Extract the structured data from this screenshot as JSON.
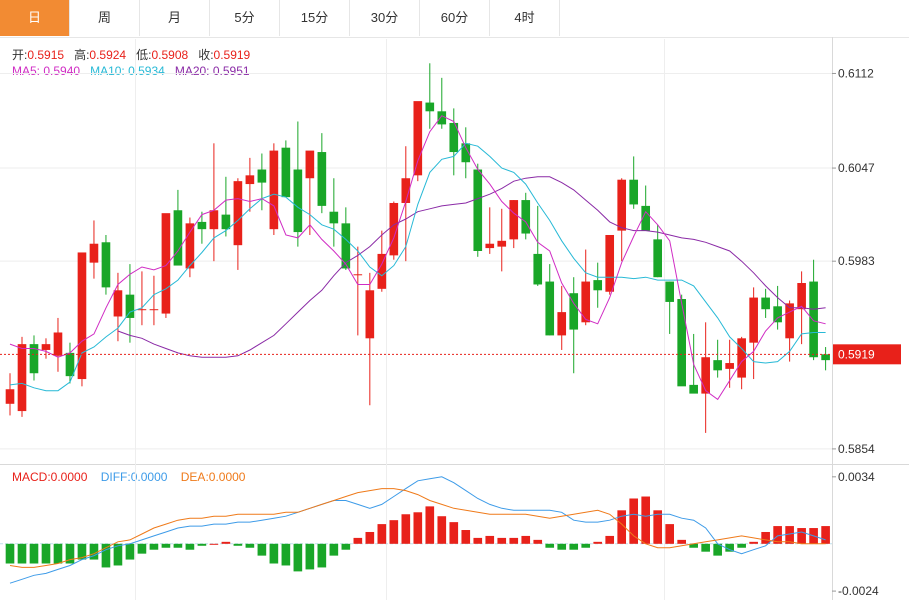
{
  "tabs": [
    {
      "label": "日",
      "active": true
    },
    {
      "label": "周"
    },
    {
      "label": "月"
    },
    {
      "label": "5分"
    },
    {
      "label": "15分"
    },
    {
      "label": "30分"
    },
    {
      "label": "60分"
    },
    {
      "label": "4时"
    }
  ],
  "info": {
    "open_label": "开:",
    "open_value": "0.5915",
    "high_label": "高:",
    "high_value": "0.5924",
    "low_label": "低:",
    "low_value": "0.5908",
    "close_label": "收:",
    "close_value": "0.5919",
    "ma5_label": "MA5:",
    "ma5_value": "0.5940",
    "ma10_label": "MA10:",
    "ma10_value": "0.5934",
    "ma20_label": "MA20:",
    "ma20_value": "0.5951"
  },
  "macd_info": {
    "macd_label": "MACD:",
    "macd_value": "0.0000",
    "diff_label": "DIFF:",
    "diff_value": "0.0000",
    "dea_label": "DEA:",
    "dea_value": "0.0000"
  },
  "colors": {
    "up": "#e8211a",
    "down": "#19a628",
    "ma5": "#d02cc4",
    "ma10": "#27b9d6",
    "ma20": "#8a2aa6",
    "diff": "#3d9be8",
    "dea": "#ef7a1a",
    "accent": "#f28b33"
  },
  "chart_data": [
    {
      "type": "candlestick",
      "ylim": [
        0.5845,
        0.6135
      ],
      "yticks": [
        "0.6112",
        "0.6047",
        "0.5983",
        "0.5854"
      ],
      "last_price": "0.5919",
      "candles": [
        [
          0.5885,
          0.5906,
          0.5877,
          0.5895
        ],
        [
          0.588,
          0.5931,
          0.5876,
          0.5926
        ],
        [
          0.5926,
          0.5932,
          0.5901,
          0.5906
        ],
        [
          0.5922,
          0.593,
          0.5916,
          0.5926
        ],
        [
          0.5918,
          0.5944,
          0.5907,
          0.5934
        ],
        [
          0.592,
          0.5927,
          0.5899,
          0.5904
        ],
        [
          0.5902,
          0.5931,
          0.5897,
          0.5989
        ],
        [
          0.5982,
          0.6011,
          0.5971,
          0.5995
        ],
        [
          0.5996,
          0.6001,
          0.596,
          0.5965
        ],
        [
          0.5945,
          0.5975,
          0.5928,
          0.5963
        ],
        [
          0.596,
          0.5981,
          0.5927,
          0.5944
        ],
        [
          0.595,
          0.5976,
          0.5939,
          0.595
        ],
        [
          0.595,
          0.5973,
          0.5939,
          0.595
        ],
        [
          0.5947,
          0.6,
          0.5944,
          0.6016
        ],
        [
          0.6018,
          0.6032,
          0.5993,
          0.598
        ],
        [
          0.5978,
          0.6013,
          0.5972,
          0.6009
        ],
        [
          0.601,
          0.6017,
          0.5995,
          0.6005
        ],
        [
          0.6005,
          0.6064,
          0.5983,
          0.6018
        ],
        [
          0.6015,
          0.6041,
          0.6,
          0.6005
        ],
        [
          0.5994,
          0.604,
          0.5977,
          0.6038
        ],
        [
          0.6036,
          0.6054,
          0.6017,
          0.6042
        ],
        [
          0.6046,
          0.6057,
          0.6018,
          0.6037
        ],
        [
          0.6005,
          0.6064,
          0.6001,
          0.6059
        ],
        [
          0.6061,
          0.6066,
          0.6027,
          0.6027
        ],
        [
          0.6046,
          0.6079,
          0.5993,
          0.6003
        ],
        [
          0.604,
          0.6052,
          0.6001,
          0.6059
        ],
        [
          0.6058,
          0.6071,
          0.6016,
          0.6021
        ],
        [
          0.6017,
          0.604,
          0.5993,
          0.6009
        ],
        [
          0.6009,
          0.602,
          0.5977,
          0.5978
        ],
        [
          0.5974,
          0.5993,
          0.5932,
          0.5974
        ],
        [
          0.593,
          0.5975,
          0.5884,
          0.5963
        ],
        [
          0.5964,
          0.6004,
          0.5962,
          0.5988
        ],
        [
          0.5987,
          0.6024,
          0.5984,
          0.6023
        ],
        [
          0.6023,
          0.6062,
          0.5983,
          0.604
        ],
        [
          0.6042,
          0.606,
          0.6038,
          0.6093
        ],
        [
          0.6092,
          0.6119,
          0.6074,
          0.6086
        ],
        [
          0.6086,
          0.6109,
          0.6074,
          0.6077
        ],
        [
          0.6078,
          0.6088,
          0.6042,
          0.6058
        ],
        [
          0.6064,
          0.6075,
          0.604,
          0.6051
        ],
        [
          0.6046,
          0.605,
          0.5986,
          0.599
        ],
        [
          0.5992,
          0.602,
          0.5988,
          0.5995
        ],
        [
          0.5993,
          0.6019,
          0.5976,
          0.5997
        ],
        [
          0.5998,
          0.6025,
          0.5992,
          0.6025
        ],
        [
          0.6025,
          0.603,
          0.5998,
          0.6002
        ],
        [
          0.5988,
          0.6021,
          0.5966,
          0.5967
        ],
        [
          0.5969,
          0.5981,
          0.5932,
          0.5932
        ],
        [
          0.5932,
          0.5966,
          0.5922,
          0.5948
        ],
        [
          0.5961,
          0.5972,
          0.5906,
          0.5936
        ],
        [
          0.5941,
          0.5991,
          0.5939,
          0.5969
        ],
        [
          0.597,
          0.5982,
          0.5951,
          0.5963
        ],
        [
          0.5962,
          0.5998,
          0.596,
          0.6001
        ],
        [
          0.6004,
          0.604,
          0.5983,
          0.6039
        ],
        [
          0.6039,
          0.6055,
          0.6019,
          0.6022
        ],
        [
          0.6021,
          0.6035,
          0.6006,
          0.6004
        ],
        [
          0.5998,
          0.6008,
          0.5972,
          0.5972
        ],
        [
          0.5969,
          0.5969,
          0.5933,
          0.5955
        ],
        [
          0.5957,
          0.596,
          0.59,
          0.5897
        ],
        [
          0.5898,
          0.5933,
          0.5893,
          0.5892
        ],
        [
          0.5892,
          0.5941,
          0.5865,
          0.5917
        ],
        [
          0.5915,
          0.5929,
          0.5903,
          0.5908
        ],
        [
          0.5909,
          0.5929,
          0.5896,
          0.5913
        ],
        [
          0.5903,
          0.5931,
          0.5895,
          0.593
        ],
        [
          0.5927,
          0.5965,
          0.5902,
          0.5958
        ],
        [
          0.5958,
          0.5964,
          0.5944,
          0.595
        ],
        [
          0.5952,
          0.5966,
          0.5936,
          0.5941
        ],
        [
          0.593,
          0.5956,
          0.5914,
          0.5954
        ],
        [
          0.595,
          0.5976,
          0.5926,
          0.5968
        ],
        [
          0.5969,
          0.5984,
          0.5915,
          0.5917
        ],
        [
          0.5919,
          0.5924,
          0.5908,
          0.5915
        ]
      ],
      "ma5": [
        0.5926,
        0.5923,
        0.5923,
        0.5921,
        0.5917,
        0.592,
        0.5928,
        0.5933,
        0.5951,
        0.5967,
        0.5974,
        0.5979,
        0.5977,
        0.598,
        0.599,
        0.6003,
        0.6015,
        0.6018,
        0.6025,
        0.6026,
        0.6024,
        0.6026,
        0.6021,
        0.6001,
        0.5999,
        0.6008,
        0.5998,
        0.599,
        0.5981,
        0.5967,
        0.5967,
        0.5981,
        0.5999,
        0.6024,
        0.6052,
        0.6072,
        0.6083,
        0.6079,
        0.6061,
        0.6046,
        0.6036,
        0.6024,
        0.6016,
        0.601,
        0.5996,
        0.599,
        0.5968,
        0.5954,
        0.5943,
        0.594,
        0.5958,
        0.5982,
        0.6,
        0.6017,
        0.6008,
        0.5997,
        0.5954,
        0.5912,
        0.5894,
        0.5888,
        0.5901,
        0.5914,
        0.5921,
        0.5935,
        0.5944,
        0.5948,
        0.5952,
        0.5942,
        0.594
      ],
      "ma10": [
        0.5898,
        0.5899,
        0.5896,
        0.5894,
        0.5894,
        0.59,
        0.592,
        0.5924,
        0.5931,
        0.5937,
        0.5948,
        0.5951,
        0.596,
        0.5964,
        0.597,
        0.598,
        0.5989,
        0.5999,
        0.6004,
        0.6011,
        0.6019,
        0.6026,
        0.6029,
        0.6027,
        0.602,
        0.6015,
        0.6008,
        0.6005,
        0.5998,
        0.599,
        0.5979,
        0.5973,
        0.598,
        0.5993,
        0.6022,
        0.6044,
        0.6053,
        0.6055,
        0.6064,
        0.6062,
        0.6055,
        0.6047,
        0.6044,
        0.6036,
        0.6023,
        0.6011,
        0.5997,
        0.5985,
        0.5975,
        0.5972,
        0.5972,
        0.5972,
        0.5971,
        0.5972,
        0.597,
        0.597,
        0.597,
        0.5966,
        0.5955,
        0.5944,
        0.5931,
        0.5923,
        0.5914,
        0.5913,
        0.5914,
        0.5921,
        0.5933,
        0.5934,
        0.5934
      ],
      "ma20": [
        0.5935,
        0.5932,
        0.593,
        0.5926,
        0.5923,
        0.592,
        0.5918,
        0.5917,
        0.5917,
        0.5917,
        0.5918,
        0.5922,
        0.5927,
        0.5932,
        0.594,
        0.5948,
        0.5956,
        0.5963,
        0.5973,
        0.5982,
        0.5987,
        0.5993,
        0.6001,
        0.6008,
        0.6012,
        0.6017,
        0.6019,
        0.6021,
        0.6022,
        0.6023,
        0.6026,
        0.6029,
        0.6033,
        0.6038,
        0.604,
        0.6041,
        0.6041,
        0.6037,
        0.6032,
        0.6025,
        0.6018,
        0.601,
        0.6006,
        0.6004,
        0.6004,
        0.6003,
        0.6001,
        0.5999,
        0.5998,
        0.5996,
        0.5993,
        0.599,
        0.5983,
        0.5975,
        0.5966,
        0.5958,
        0.5951,
        0.5951,
        0.595,
        0.5951
      ],
      "ma20_start": 9
    },
    {
      "type": "bar",
      "ylim": [
        -0.0027,
        0.004
      ],
      "yticks": [
        "0.0034",
        "-0.0024"
      ],
      "macd": [
        -0.001,
        -0.001,
        -0.001,
        -0.001,
        -0.001,
        -0.001,
        -0.0008,
        -0.0008,
        -0.0012,
        -0.0011,
        -0.0008,
        -0.0005,
        -0.0003,
        -0.0002,
        -0.0002,
        -0.0003,
        -0.0001,
        0.0,
        0.0001,
        -0.0001,
        -0.0002,
        -0.0006,
        -0.001,
        -0.0011,
        -0.0014,
        -0.0013,
        -0.0012,
        -0.0006,
        -0.0003,
        0.0003,
        0.0006,
        0.001,
        0.0012,
        0.0015,
        0.0016,
        0.0019,
        0.0014,
        0.0011,
        0.0007,
        0.0003,
        0.0004,
        0.0003,
        0.0003,
        0.0004,
        0.0002,
        -0.0002,
        -0.0003,
        -0.0003,
        -0.0002,
        0.0001,
        0.0004,
        0.0017,
        0.0023,
        0.0024,
        0.0017,
        0.001,
        0.0002,
        -0.0002,
        -0.0004,
        -0.0006,
        -0.0004,
        -0.0002,
        0.0001,
        0.0006,
        0.0009,
        0.0009,
        0.0008,
        0.0008,
        0.0009,
        0.0007
      ],
      "diff": [
        -0.002,
        -0.0018,
        -0.0016,
        -0.0015,
        -0.0013,
        -0.0011,
        -0.0008,
        -0.0006,
        -0.0003,
        -0.0001,
        0.0,
        0.0002,
        0.0004,
        0.0006,
        0.0008,
        0.0009,
        0.0009,
        0.001,
        0.001,
        0.0011,
        0.0011,
        0.0012,
        0.0013,
        0.0014,
        0.0016,
        0.0018,
        0.002,
        0.0022,
        0.0022,
        0.002,
        0.0018,
        0.002,
        0.0024,
        0.0028,
        0.0032,
        0.0033,
        0.0034,
        0.0031,
        0.0027,
        0.0023,
        0.002,
        0.0018,
        0.0017,
        0.0017,
        0.0017,
        0.0017,
        0.0016,
        0.0012,
        0.0011,
        0.0011,
        0.0012,
        0.0014,
        0.0015,
        0.0014,
        0.0015,
        0.0015,
        0.0013,
        0.0012,
        0.0008,
        0.0,
        -0.0003,
        -0.0005,
        -0.0003,
        -0.0001,
        0.0004,
        0.0005,
        0.0006,
        0.0004,
        0.0002,
        0.0
      ],
      "dea": [
        -0.0011,
        -0.0012,
        -0.0012,
        -0.0011,
        -0.001,
        -0.0008,
        -0.0007,
        -0.0005,
        -0.0002,
        0.0001,
        0.0002,
        0.0005,
        0.0008,
        0.001,
        0.0012,
        0.0013,
        0.0013,
        0.0014,
        0.0014,
        0.0015,
        0.0015,
        0.0015,
        0.0015,
        0.0016,
        0.0016,
        0.0018,
        0.002,
        0.0022,
        0.0024,
        0.0026,
        0.0027,
        0.0028,
        0.0028,
        0.0027,
        0.0025,
        0.0022,
        0.002,
        0.0018,
        0.0017,
        0.0016,
        0.0015,
        0.0015,
        0.0015,
        0.0015,
        0.0014,
        0.0013,
        0.0014,
        0.0015,
        0.0016,
        0.0017,
        0.0015,
        0.001,
        0.0004,
        0.0,
        -0.0002,
        -0.0002,
        -0.0001,
        0.0,
        0.0001,
        0.0002,
        0.0003,
        0.0004,
        0.0003,
        0.0002,
        0.0001,
        0.0001,
        0.0,
        0.0,
        0.0
      ],
      "zero_line": "0.0000"
    }
  ]
}
